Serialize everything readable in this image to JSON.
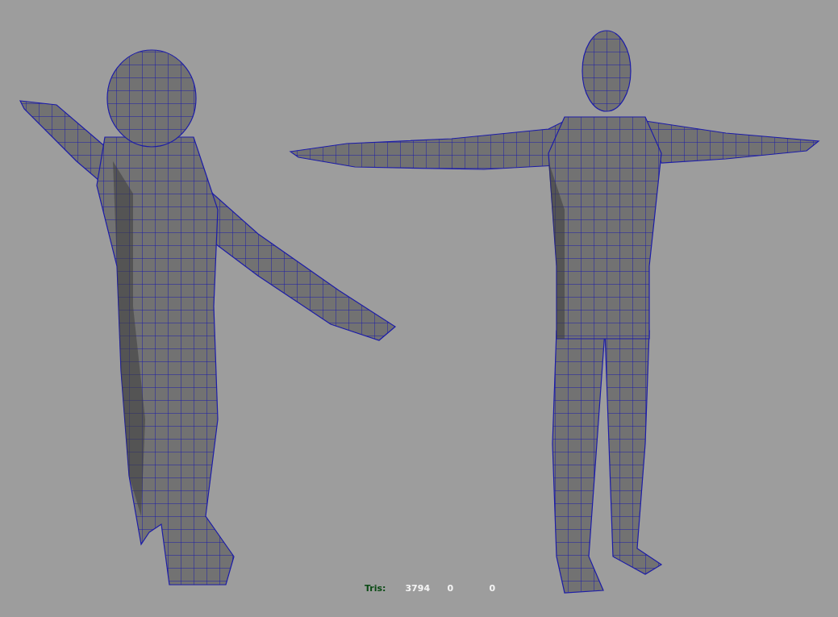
{
  "viewport": {
    "hud": {
      "label": "Tris:",
      "values": [
        "3794",
        "0",
        "0"
      ]
    }
  }
}
